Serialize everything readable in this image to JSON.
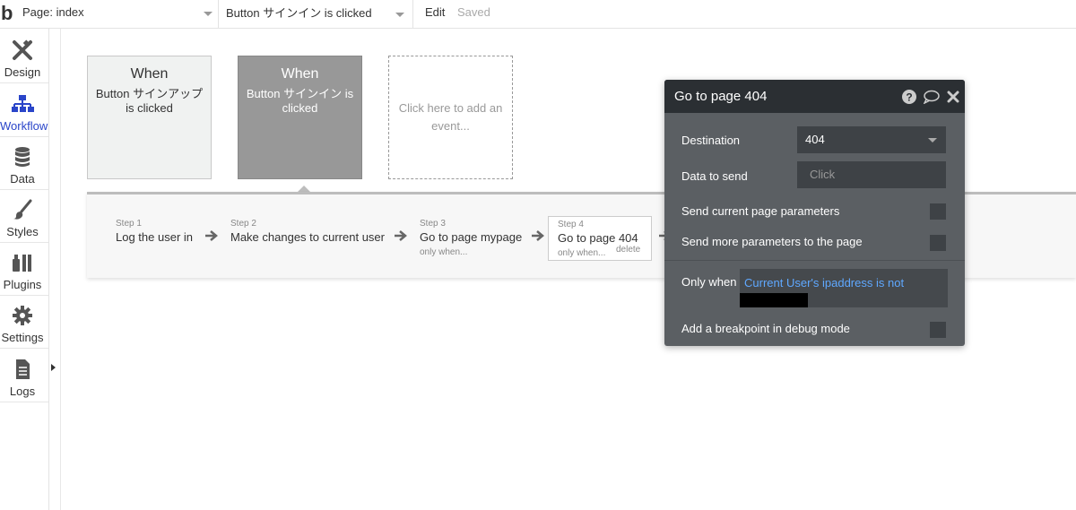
{
  "topbar": {
    "logo": "b",
    "page_selector": "Page: index",
    "event_selector": "Button サインイン is clicked",
    "edit_label": "Edit",
    "saved_label": "Saved"
  },
  "sidebar": {
    "items": [
      {
        "label": "Design",
        "icon": "design-icon"
      },
      {
        "label": "Workflow",
        "icon": "workflow-icon",
        "active": true
      },
      {
        "label": "Data",
        "icon": "database-icon"
      },
      {
        "label": "Styles",
        "icon": "brush-icon"
      },
      {
        "label": "Plugins",
        "icon": "plug-icon"
      },
      {
        "label": "Settings",
        "icon": "gear-icon"
      },
      {
        "label": "Logs",
        "icon": "document-icon"
      }
    ]
  },
  "events": [
    {
      "when": "When",
      "description": "Button サインアップ is clicked"
    },
    {
      "when": "When",
      "description": "Button サインイン is clicked",
      "selected": true
    }
  ],
  "add_event_label": "Click here to add an event...",
  "steps": [
    {
      "number": "Step 1",
      "name": "Log the user in",
      "condition": ""
    },
    {
      "number": "Step 2",
      "name": "Make changes to current user",
      "condition": ""
    },
    {
      "number": "Step 3",
      "name": "Go to page mypage",
      "condition": "only when..."
    },
    {
      "number": "Step 4",
      "name": "Go to page 404",
      "condition": "only when...",
      "delete": "delete"
    }
  ],
  "modal": {
    "title": "Go to page 404",
    "destination_label": "Destination",
    "destination_value": "404",
    "data_to_send_label": "Data to send",
    "data_to_send_placeholder": "Click",
    "send_current_params_label": "Send current page parameters",
    "send_more_params_label": "Send more parameters to the page",
    "only_when_label": "Only when",
    "only_when_expression": "Current User's ipaddress is not",
    "breakpoint_label": "Add a breakpoint in debug mode"
  },
  "colors": {
    "accent": "#2a45c9",
    "modal_bg": "#5b5f63",
    "modal_header": "#2b2f33",
    "expression": "#5fa8ff"
  }
}
